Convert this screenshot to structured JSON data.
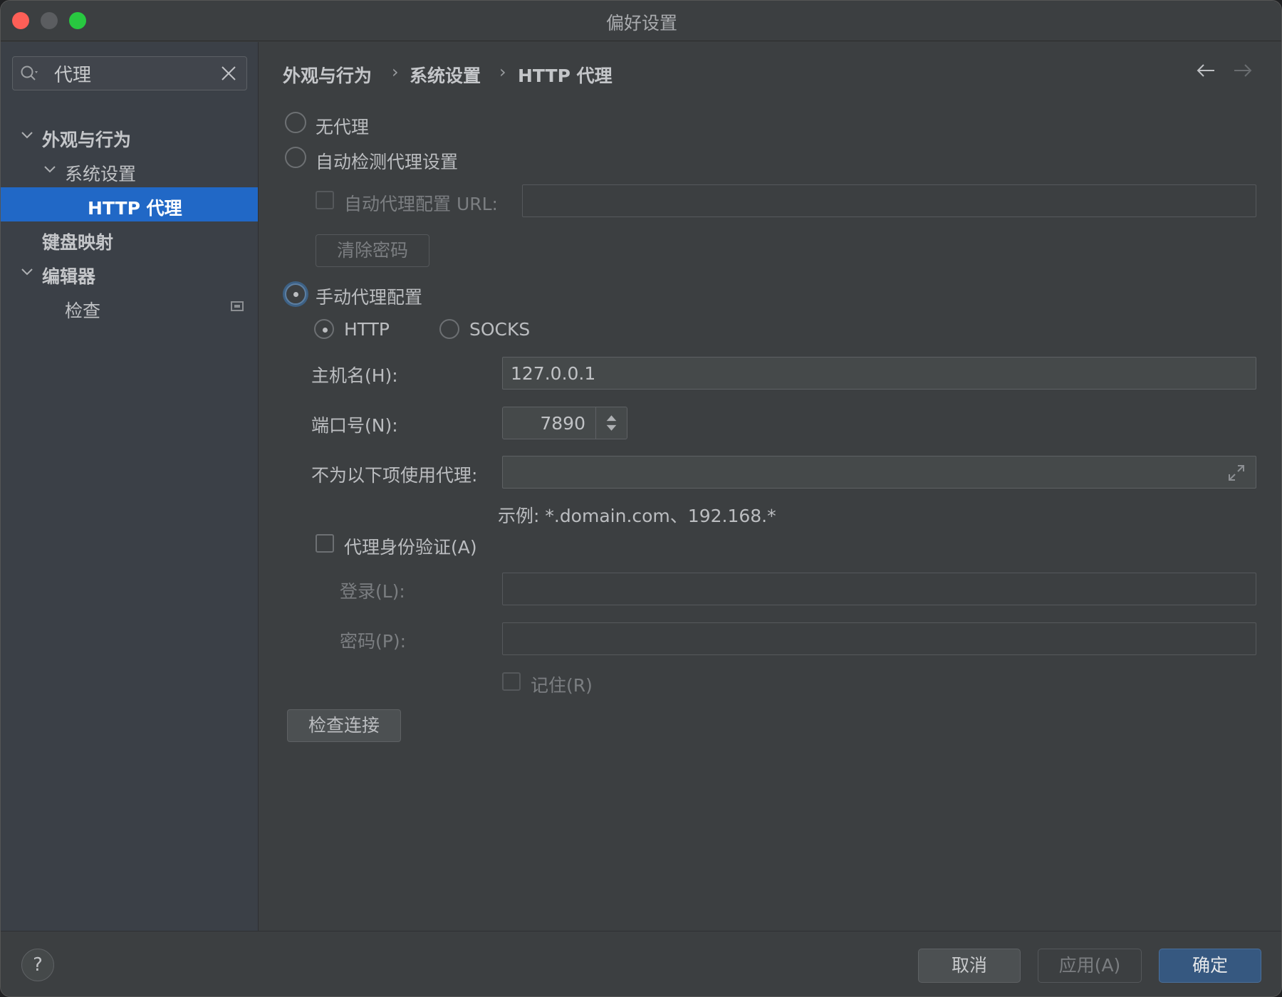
{
  "window": {
    "title": "偏好设置"
  },
  "search": {
    "value": "代理"
  },
  "sidebar": {
    "items": [
      {
        "label": "外观与行为"
      },
      {
        "label": "系统设置"
      },
      {
        "label": "HTTP 代理"
      },
      {
        "label": "键盘映射"
      },
      {
        "label": "编辑器"
      },
      {
        "label": "检查"
      }
    ]
  },
  "breadcrumb": [
    "外观与行为",
    "系统设置",
    "HTTP 代理"
  ],
  "proxy": {
    "no_proxy": "无代理",
    "auto_detect": "自动检测代理设置",
    "auto_config_url_label": "自动代理配置 URL:",
    "auto_config_url_value": "",
    "clear_password": "清除密码",
    "manual": "手动代理配置",
    "protocol_http": "HTTP",
    "protocol_socks": "SOCKS",
    "host_label": "主机名(H):",
    "host_value": "127.0.0.1",
    "port_label": "端口号(N):",
    "port_value": "7890",
    "no_proxy_for_label": "不为以下项使用代理:",
    "no_proxy_for_value": "",
    "example": "示例: *.domain.com、192.168.*",
    "auth_label": "代理身份验证(A)",
    "login_label": "登录(L):",
    "login_value": "",
    "password_label": "密码(P):",
    "password_value": "",
    "remember_label": "记住(R)",
    "check_connection": "检查连接"
  },
  "footer": {
    "help": "?",
    "cancel": "取消",
    "apply": "应用(A)",
    "ok": "确定"
  },
  "colors": {
    "accent": "#2168c6",
    "primary_button": "#365880"
  }
}
